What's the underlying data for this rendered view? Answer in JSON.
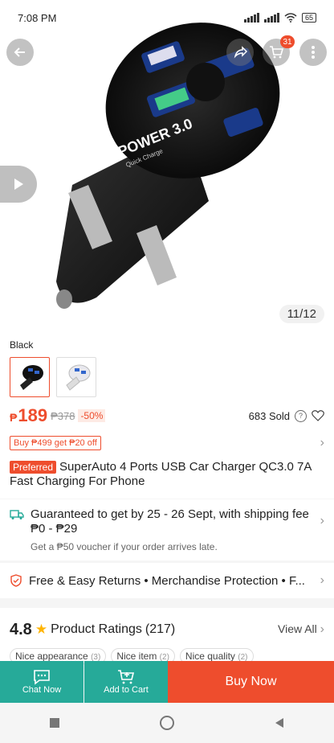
{
  "status_bar": {
    "time": "7:08 PM",
    "battery": "65"
  },
  "hero": {
    "cart_badge": "31",
    "image_counter": "11/12",
    "charger_label": "POWER 3.0",
    "charger_sub": "Quick Charge"
  },
  "variant": {
    "label": "Black",
    "options": [
      "Black",
      "White"
    ]
  },
  "price": {
    "currency": "₱",
    "current": "189",
    "original": "₱378",
    "discount": "-50%",
    "sold": "683 Sold"
  },
  "promo": {
    "tag": "Buy ₱499 get ₱20 off"
  },
  "product": {
    "badge": "Preferred",
    "title": "SuperAuto 4 Ports USB Car Charger QC3.0 7A Fast Charging For Phone"
  },
  "shipping": {
    "main": "Guaranteed to get by 25 - 26 Sept, with shipping fee ₱0 - ₱29",
    "sub": "Get a ₱50 voucher if your order arrives late."
  },
  "assurance": {
    "text": "Free & Easy Returns  •  Merchandise Protection  •  F..."
  },
  "ratings": {
    "score": "4.8",
    "title": "Product Ratings",
    "count": "(217)",
    "view_all": "View All",
    "chips": [
      {
        "label": "Nice appearance",
        "count": "(3)"
      },
      {
        "label": "Nice item",
        "count": "(2)"
      },
      {
        "label": "Nice quality",
        "count": "(2)"
      }
    ]
  },
  "bottom_bar": {
    "chat": "Chat Now",
    "cart": "Add to Cart",
    "buy": "Buy Now"
  },
  "colors": {
    "brand": "#ee4d2d",
    "teal": "#26aa99"
  }
}
